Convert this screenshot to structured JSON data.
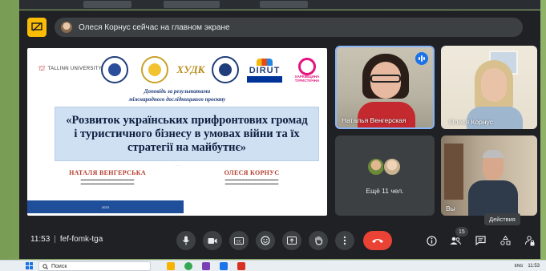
{
  "banner": {
    "text": "Олеся Корнус сейчас на главном экране"
  },
  "slide": {
    "logos": {
      "tallinn": "TALLINN UNIVERSITY",
      "dirut": "DIRUT",
      "kharkiv": "ХАРКІВЩИНА ТУРИСТИЧНА"
    },
    "report_line_1": "Доповідь за результатами",
    "report_line_2": "міжнародного дослідницького проєкту",
    "title": "«Розвиток українських прифронтових громад і туристичного бізнесу в умовах війни та їх стратегії на майбутнє»",
    "authors": [
      {
        "name": "НАТАЛЯ ВЕНГЕРСЬКА"
      },
      {
        "name": "ОЛЕСЯ КОРНУС"
      }
    ],
    "year": "2023"
  },
  "tiles": {
    "speaker_name": "Наталья Венгерская",
    "second_name": "Олеся Корнус",
    "more_label": "Ещё 11 чел.",
    "self_name": "Вы"
  },
  "tooltip": "Действия",
  "controls": {
    "time": "11:53",
    "meeting_code": "fef-fomk-tga",
    "participants_count": "15"
  },
  "taskbar": {
    "search_placeholder": "Поиск",
    "lang": "ENG",
    "time": "11:53"
  },
  "colors": {
    "meet_bg": "#202124",
    "control_bg": "#3c4043",
    "end_call": "#ea4335",
    "speaking": "#1a73e8",
    "present_icon": "#fbbc04"
  }
}
